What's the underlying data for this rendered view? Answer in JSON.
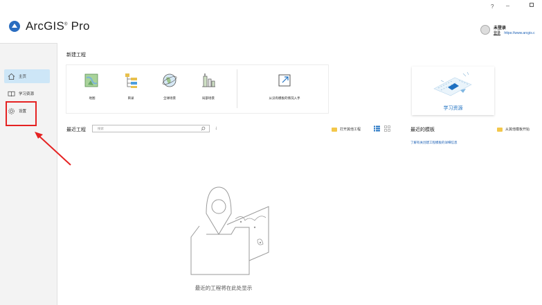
{
  "app": {
    "title": "ArcGIS",
    "title_suffix": "Pro",
    "window_controls": {
      "help": "?",
      "minimize": "–",
      "maximize": "□"
    }
  },
  "user": {
    "name": "未登录",
    "login_label": "登录",
    "portal_url": "https://www.arcgis.c"
  },
  "sidebar": {
    "items": [
      {
        "label": "主页",
        "icon": "home-icon",
        "active": true
      },
      {
        "label": "学习资源",
        "icon": "book-icon",
        "active": false
      },
      {
        "label": "设置",
        "icon": "gear-icon",
        "active": false
      }
    ]
  },
  "new_project": {
    "title": "新建工程",
    "templates": [
      {
        "label": "地图",
        "icon": "map-icon"
      },
      {
        "label": "目录",
        "icon": "catalog-icon"
      },
      {
        "label": "全球场景",
        "icon": "globe-icon"
      },
      {
        "label": "局部场景",
        "icon": "local-scene-icon"
      }
    ],
    "start_without_label": "从没有模板的情况入手"
  },
  "learning_card": {
    "label": "学习资源"
  },
  "recent_projects": {
    "title": "最近工程",
    "search_placeholder": "搜索",
    "open_other_label": "打开其他工程",
    "empty_text": "最近的工程将在此处显示"
  },
  "recent_templates": {
    "title": "最近的模板",
    "link_text": "了解有关创建工程模板的详细信息",
    "start_without_label": "从其他模板开始"
  },
  "colors": {
    "accent": "#1e70c1",
    "sidebar_active": "#cde6f7",
    "annotation_red": "#e52222"
  }
}
